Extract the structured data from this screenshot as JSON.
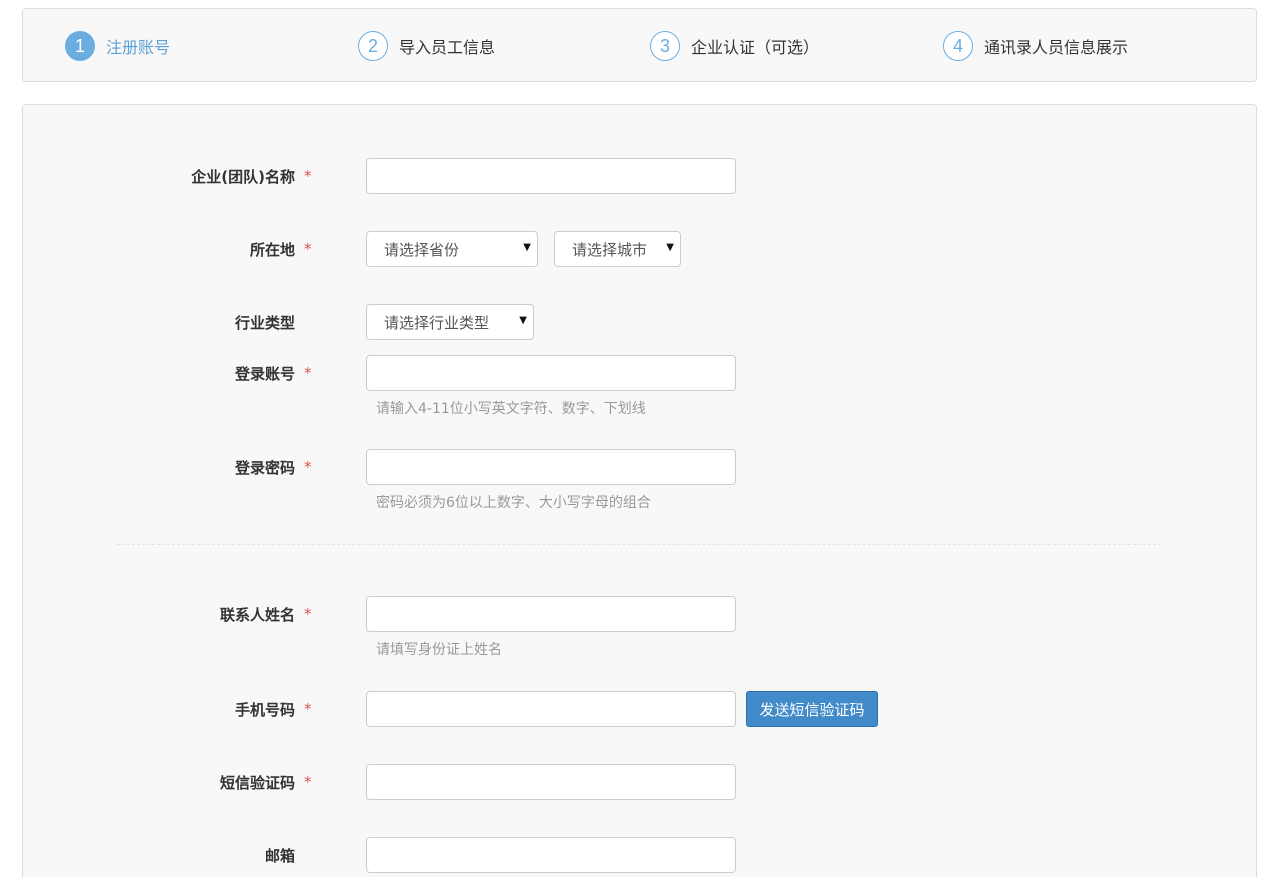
{
  "steps": [
    {
      "num": "1",
      "label": "注册账号",
      "active": true
    },
    {
      "num": "2",
      "label": "导入员工信息",
      "active": false
    },
    {
      "num": "3",
      "label": "企业认证（可选）",
      "active": false
    },
    {
      "num": "4",
      "label": "通讯录人员信息展示",
      "active": false
    }
  ],
  "form": {
    "company_name": {
      "label": "企业(团队)名称",
      "required": "*",
      "value": ""
    },
    "location": {
      "label": "所在地",
      "required": "*",
      "province_select": "请选择省份",
      "city_select": "请选择城市"
    },
    "industry": {
      "label": "行业类型",
      "select": "请选择行业类型"
    },
    "account": {
      "label": "登录账号",
      "required": "*",
      "value": "",
      "hint": "请输入4-11位小写英文字符、数字、下划线"
    },
    "password": {
      "label": "登录密码",
      "required": "*",
      "value": "",
      "hint": "密码必须为6位以上数字、大小写字母的组合"
    },
    "contact_name": {
      "label": "联系人姓名",
      "required": "*",
      "value": "",
      "hint": "请填写身份证上姓名"
    },
    "phone": {
      "label": "手机号码",
      "required": "*",
      "value": "",
      "send_sms_button": "发送短信验证码"
    },
    "sms_code": {
      "label": "短信验证码",
      "required": "*",
      "value": ""
    },
    "email": {
      "label": "邮箱",
      "value": ""
    }
  },
  "icons": {
    "select_caret": "triangle-down-icon"
  },
  "colors": {
    "accent": "#5ba2d8",
    "required": "#d9534f",
    "button": "#428bca",
    "hint": "#999999"
  }
}
